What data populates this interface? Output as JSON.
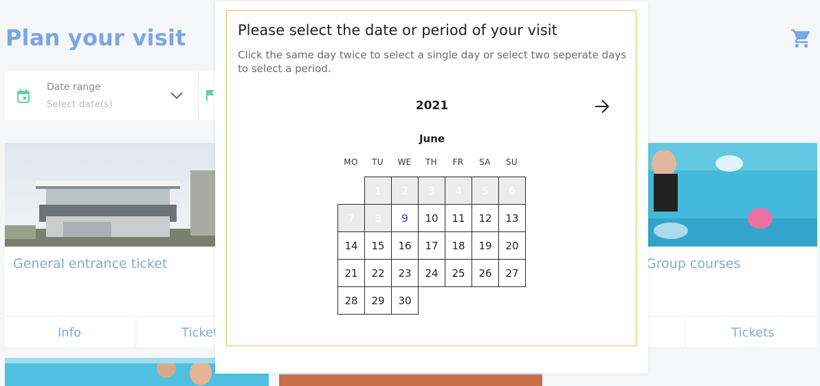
{
  "page": {
    "title": "Plan your visit"
  },
  "filter": {
    "label": "Date range",
    "placeholder": "Select date(s)"
  },
  "cards": [
    {
      "title": "General entrance ticket",
      "actions": [
        "Info",
        "Ticket"
      ]
    },
    {
      "title": "Group courses",
      "actions": [
        "Tickets"
      ]
    }
  ],
  "modal": {
    "title": "Please select the date or period of your visit",
    "subtitle": "Click the same day twice to select a single day or select two seperate days to select a period.",
    "year": "2021",
    "month": "June",
    "weekdays": [
      "MO",
      "TU",
      "WE",
      "TH",
      "FR",
      "SA",
      "SU"
    ],
    "days": [
      "1",
      "2",
      "3",
      "4",
      "5",
      "6",
      "7",
      "8",
      "9",
      "10",
      "11",
      "12",
      "13",
      "14",
      "15",
      "16",
      "17",
      "18",
      "19",
      "20",
      "21",
      "22",
      "23",
      "24",
      "25",
      "26",
      "27",
      "28",
      "29",
      "30"
    ],
    "disabled_days": [
      "1",
      "2",
      "3",
      "4",
      "5",
      "6",
      "7",
      "8"
    ],
    "highlight_day": "9",
    "first_weekday_index": 1
  },
  "colors": {
    "accent": "#7aa7e4",
    "border_accent": "#e2c14a",
    "filter_icon": "#5fd69a"
  }
}
